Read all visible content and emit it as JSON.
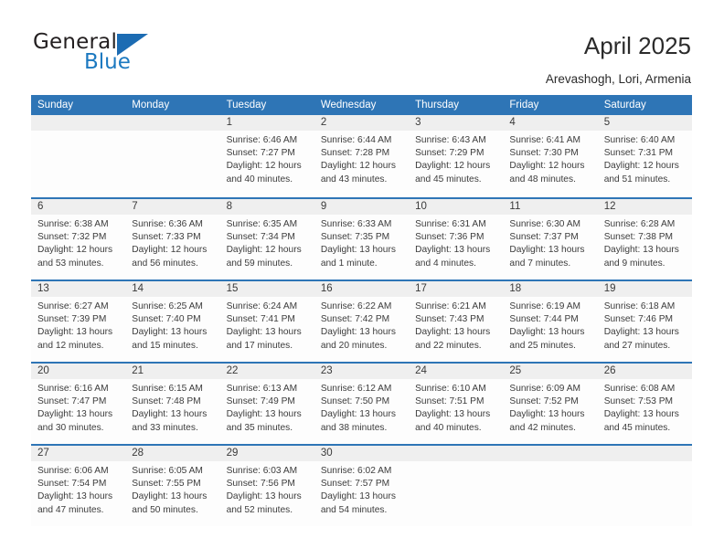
{
  "brand": {
    "name_part1": "General",
    "name_part2": "Blue",
    "accent_color": "#1c6cb3"
  },
  "header": {
    "title": "April 2025",
    "subtitle": "Arevashogh, Lori, Armenia"
  },
  "theme": {
    "header_blue": "#2e75b6",
    "number_band_gray": "#efefef",
    "text_color": "#3c3c3c"
  },
  "weekdays": [
    "Sunday",
    "Monday",
    "Tuesday",
    "Wednesday",
    "Thursday",
    "Friday",
    "Saturday"
  ],
  "weeks": [
    [
      {
        "day": "",
        "lines": []
      },
      {
        "day": "",
        "lines": []
      },
      {
        "day": "1",
        "lines": [
          "Sunrise: 6:46 AM",
          "Sunset: 7:27 PM",
          "Daylight: 12 hours",
          "and 40 minutes."
        ]
      },
      {
        "day": "2",
        "lines": [
          "Sunrise: 6:44 AM",
          "Sunset: 7:28 PM",
          "Daylight: 12 hours",
          "and 43 minutes."
        ]
      },
      {
        "day": "3",
        "lines": [
          "Sunrise: 6:43 AM",
          "Sunset: 7:29 PM",
          "Daylight: 12 hours",
          "and 45 minutes."
        ]
      },
      {
        "day": "4",
        "lines": [
          "Sunrise: 6:41 AM",
          "Sunset: 7:30 PM",
          "Daylight: 12 hours",
          "and 48 minutes."
        ]
      },
      {
        "day": "5",
        "lines": [
          "Sunrise: 6:40 AM",
          "Sunset: 7:31 PM",
          "Daylight: 12 hours",
          "and 51 minutes."
        ]
      }
    ],
    [
      {
        "day": "6",
        "lines": [
          "Sunrise: 6:38 AM",
          "Sunset: 7:32 PM",
          "Daylight: 12 hours",
          "and 53 minutes."
        ]
      },
      {
        "day": "7",
        "lines": [
          "Sunrise: 6:36 AM",
          "Sunset: 7:33 PM",
          "Daylight: 12 hours",
          "and 56 minutes."
        ]
      },
      {
        "day": "8",
        "lines": [
          "Sunrise: 6:35 AM",
          "Sunset: 7:34 PM",
          "Daylight: 12 hours",
          "and 59 minutes."
        ]
      },
      {
        "day": "9",
        "lines": [
          "Sunrise: 6:33 AM",
          "Sunset: 7:35 PM",
          "Daylight: 13 hours",
          "and 1 minute."
        ]
      },
      {
        "day": "10",
        "lines": [
          "Sunrise: 6:31 AM",
          "Sunset: 7:36 PM",
          "Daylight: 13 hours",
          "and 4 minutes."
        ]
      },
      {
        "day": "11",
        "lines": [
          "Sunrise: 6:30 AM",
          "Sunset: 7:37 PM",
          "Daylight: 13 hours",
          "and 7 minutes."
        ]
      },
      {
        "day": "12",
        "lines": [
          "Sunrise: 6:28 AM",
          "Sunset: 7:38 PM",
          "Daylight: 13 hours",
          "and 9 minutes."
        ]
      }
    ],
    [
      {
        "day": "13",
        "lines": [
          "Sunrise: 6:27 AM",
          "Sunset: 7:39 PM",
          "Daylight: 13 hours",
          "and 12 minutes."
        ]
      },
      {
        "day": "14",
        "lines": [
          "Sunrise: 6:25 AM",
          "Sunset: 7:40 PM",
          "Daylight: 13 hours",
          "and 15 minutes."
        ]
      },
      {
        "day": "15",
        "lines": [
          "Sunrise: 6:24 AM",
          "Sunset: 7:41 PM",
          "Daylight: 13 hours",
          "and 17 minutes."
        ]
      },
      {
        "day": "16",
        "lines": [
          "Sunrise: 6:22 AM",
          "Sunset: 7:42 PM",
          "Daylight: 13 hours",
          "and 20 minutes."
        ]
      },
      {
        "day": "17",
        "lines": [
          "Sunrise: 6:21 AM",
          "Sunset: 7:43 PM",
          "Daylight: 13 hours",
          "and 22 minutes."
        ]
      },
      {
        "day": "18",
        "lines": [
          "Sunrise: 6:19 AM",
          "Sunset: 7:44 PM",
          "Daylight: 13 hours",
          "and 25 minutes."
        ]
      },
      {
        "day": "19",
        "lines": [
          "Sunrise: 6:18 AM",
          "Sunset: 7:46 PM",
          "Daylight: 13 hours",
          "and 27 minutes."
        ]
      }
    ],
    [
      {
        "day": "20",
        "lines": [
          "Sunrise: 6:16 AM",
          "Sunset: 7:47 PM",
          "Daylight: 13 hours",
          "and 30 minutes."
        ]
      },
      {
        "day": "21",
        "lines": [
          "Sunrise: 6:15 AM",
          "Sunset: 7:48 PM",
          "Daylight: 13 hours",
          "and 33 minutes."
        ]
      },
      {
        "day": "22",
        "lines": [
          "Sunrise: 6:13 AM",
          "Sunset: 7:49 PM",
          "Daylight: 13 hours",
          "and 35 minutes."
        ]
      },
      {
        "day": "23",
        "lines": [
          "Sunrise: 6:12 AM",
          "Sunset: 7:50 PM",
          "Daylight: 13 hours",
          "and 38 minutes."
        ]
      },
      {
        "day": "24",
        "lines": [
          "Sunrise: 6:10 AM",
          "Sunset: 7:51 PM",
          "Daylight: 13 hours",
          "and 40 minutes."
        ]
      },
      {
        "day": "25",
        "lines": [
          "Sunrise: 6:09 AM",
          "Sunset: 7:52 PM",
          "Daylight: 13 hours",
          "and 42 minutes."
        ]
      },
      {
        "day": "26",
        "lines": [
          "Sunrise: 6:08 AM",
          "Sunset: 7:53 PM",
          "Daylight: 13 hours",
          "and 45 minutes."
        ]
      }
    ],
    [
      {
        "day": "27",
        "lines": [
          "Sunrise: 6:06 AM",
          "Sunset: 7:54 PM",
          "Daylight: 13 hours",
          "and 47 minutes."
        ]
      },
      {
        "day": "28",
        "lines": [
          "Sunrise: 6:05 AM",
          "Sunset: 7:55 PM",
          "Daylight: 13 hours",
          "and 50 minutes."
        ]
      },
      {
        "day": "29",
        "lines": [
          "Sunrise: 6:03 AM",
          "Sunset: 7:56 PM",
          "Daylight: 13 hours",
          "and 52 minutes."
        ]
      },
      {
        "day": "30",
        "lines": [
          "Sunrise: 6:02 AM",
          "Sunset: 7:57 PM",
          "Daylight: 13 hours",
          "and 54 minutes."
        ]
      },
      {
        "day": "",
        "lines": []
      },
      {
        "day": "",
        "lines": []
      },
      {
        "day": "",
        "lines": []
      }
    ]
  ]
}
